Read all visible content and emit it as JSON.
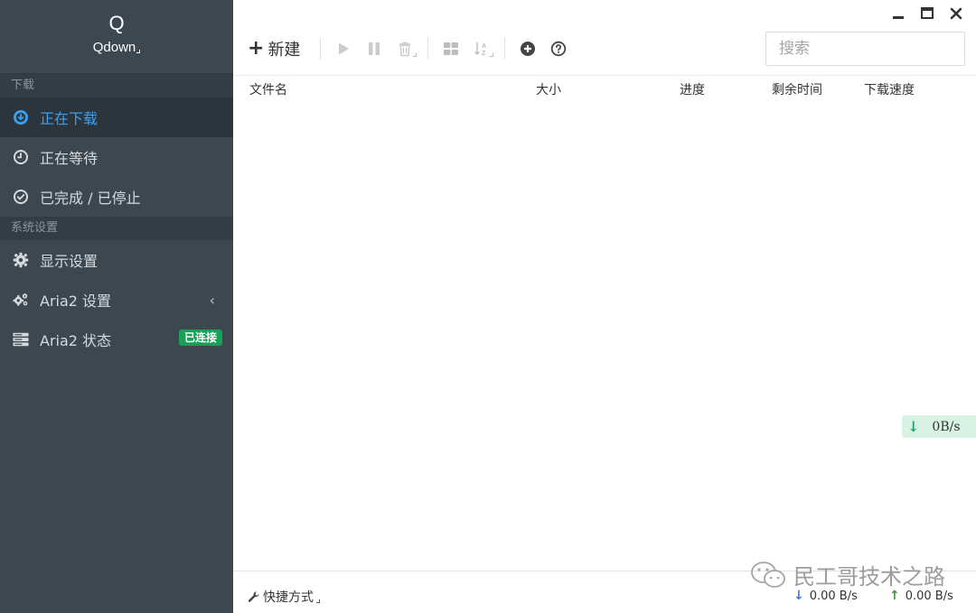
{
  "app": {
    "logo": "Q",
    "name": "Qdown"
  },
  "sidebar": {
    "section_download": "下载",
    "downloading": "正在下载",
    "waiting": "正在等待",
    "finished": "已完成 / 已停止",
    "section_settings": "系统设置",
    "display_settings": "显示设置",
    "aria2_settings": "Aria2 设置",
    "aria2_status": "Aria2 状态",
    "status_badge": "已连接",
    "chevron": "‹"
  },
  "toolbar": {
    "new_plus": "+",
    "new_label": "新建",
    "search_placeholder": "搜索"
  },
  "table": {
    "columns": [
      "文件名",
      "大小",
      "进度",
      "剩余时间",
      "下载速度"
    ]
  },
  "float_speed": {
    "value": "0B/s"
  },
  "footer": {
    "shortcut": "快捷方式",
    "download_speed": "0.00 B/s",
    "upload_speed": "0.00 B/s"
  },
  "watermark": {
    "text": "民工哥技术之路"
  },
  "colors": {
    "sidebar_bg": "#3c4750",
    "active_accent": "#3b9ff2",
    "badge_green": "#18a058",
    "download_arrow": "#3b7be0",
    "upload_arrow": "#3a9a3a"
  },
  "icons": {
    "downloading": "download-circle-icon",
    "waiting": "clock-icon",
    "finished": "check-circle-icon",
    "display_settings": "gear-icon",
    "aria2_settings": "gears-icon",
    "aria2_status": "server-icon"
  }
}
